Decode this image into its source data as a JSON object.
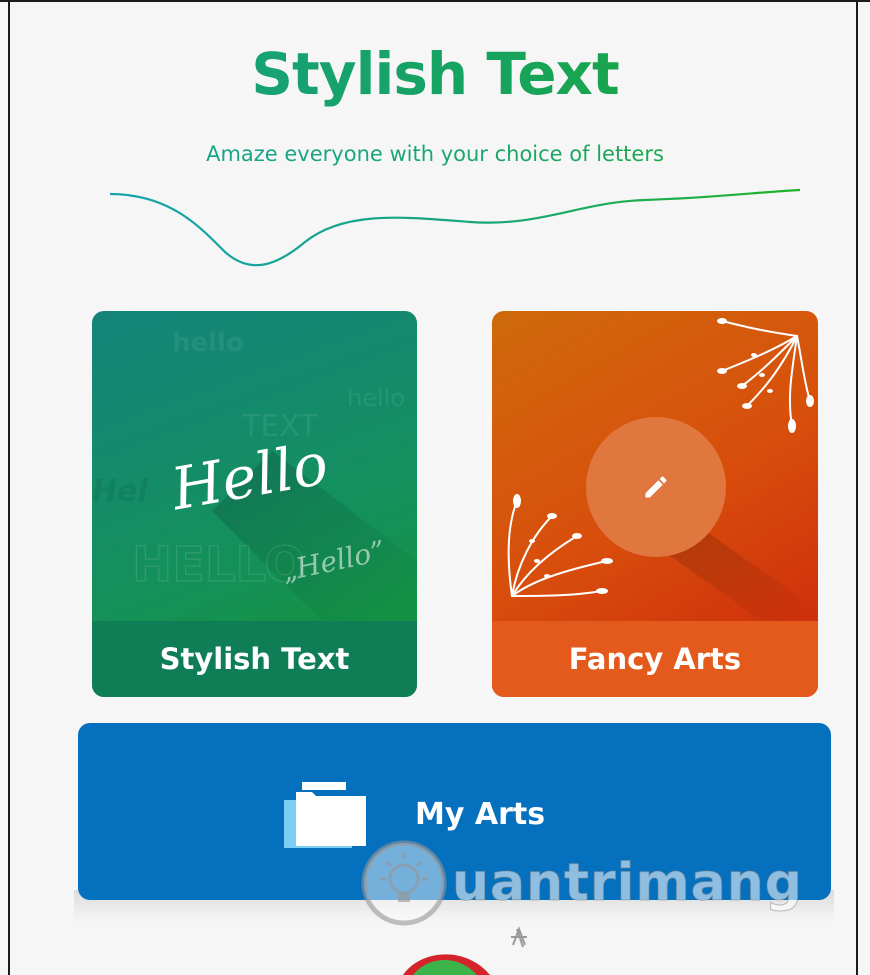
{
  "header": {
    "title": "Stylish Text",
    "subtitle": "Amaze everyone with your choice of letters"
  },
  "cards": [
    {
      "label": "Stylish Text",
      "art_words": [
        "Hello",
        "“Hello”",
        "„Hello”"
      ]
    },
    {
      "label": "Fancy Arts",
      "icon": "pencil-icon"
    }
  ],
  "my_arts": {
    "label": "My Arts",
    "icon": "folder-icon"
  },
  "watermark": {
    "text": "uantrimang",
    "icon": "lightbulb-icon"
  },
  "colors": {
    "title_gradient_start": "#14a08e",
    "title_gradient_end": "#1aa82a",
    "stylish_card": "#14905e",
    "stylish_footer": "#0f7e57",
    "fancy_card": "#d84e0c",
    "fancy_footer": "#e35a1c",
    "my_arts": "#0570bd"
  }
}
